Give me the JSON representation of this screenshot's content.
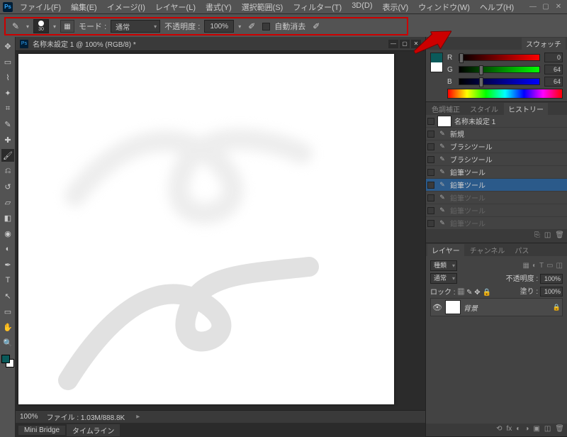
{
  "window": {
    "app_logo": "Ps",
    "menus": [
      "ファイル(F)",
      "編集(E)",
      "イメージ(I)",
      "レイヤー(L)",
      "書式(Y)",
      "選択範囲(S)",
      "フィルター(T)",
      "3D(D)",
      "表示(V)",
      "ウィンドウ(W)",
      "ヘルプ(H)"
    ]
  },
  "options_bar": {
    "brush_size": "30",
    "mode_label": "モード :",
    "mode_value": "通常",
    "opacity_label": "不透明度 :",
    "opacity_value": "100%",
    "auto_erase_label": "自動消去"
  },
  "document": {
    "tab_title": "名称未設定 1 @ 100% (RGB/8) *",
    "zoom": "100%",
    "file_status_label": "ファイル :",
    "file_status_value": "1.03M/888.8K"
  },
  "bottom_tabs": [
    "Mini Bridge",
    "タイムライン"
  ],
  "panels": {
    "swatches_tab": "スウォッチ",
    "color": {
      "r": {
        "label": "R",
        "value": "0"
      },
      "g": {
        "label": "G",
        "value": "64"
      },
      "b": {
        "label": "B",
        "value": "64"
      }
    },
    "adjust_tabs": [
      "色調補正",
      "スタイル",
      "ヒストリー"
    ],
    "history_source": "名称未設定 1",
    "history": [
      {
        "label": "新規",
        "dim": false
      },
      {
        "label": "ブラシツール",
        "dim": false
      },
      {
        "label": "ブラシツール",
        "dim": false
      },
      {
        "label": "鉛筆ツール",
        "dim": false
      },
      {
        "label": "鉛筆ツール",
        "dim": false,
        "sel": true
      },
      {
        "label": "鉛筆ツール",
        "dim": true
      },
      {
        "label": "鉛筆ツール",
        "dim": true
      },
      {
        "label": "鉛筆ツール",
        "dim": true
      }
    ],
    "layers_tabs": [
      "レイヤー",
      "チャンネル",
      "パス"
    ],
    "layers_blend": "通常",
    "layers_opacity_label": "不透明度 :",
    "layers_opacity_value": "100%",
    "layers_lock_label": "ロック :",
    "layers_fill_label": "塗り :",
    "layers_fill_value": "100%",
    "layers_kind_label": "種類",
    "layer_name": "背景"
  }
}
